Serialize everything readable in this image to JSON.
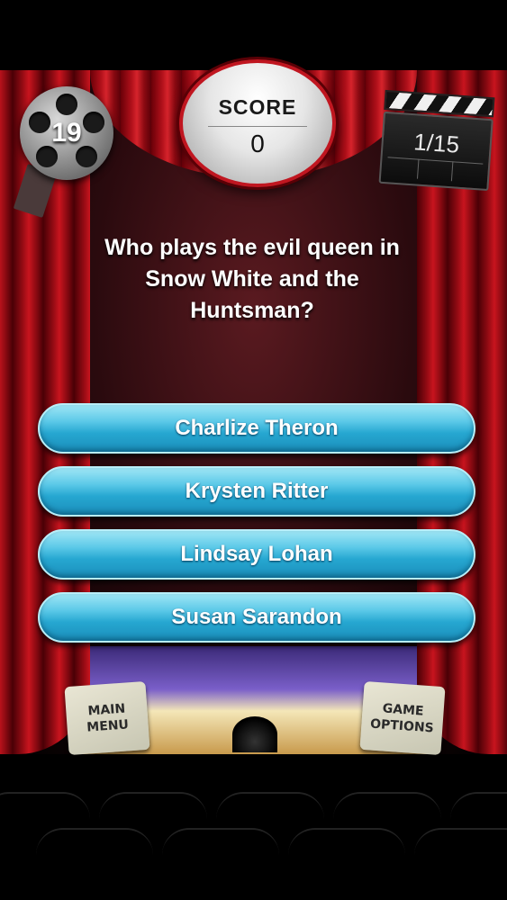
{
  "hud": {
    "timer": "19",
    "score_label": "SCORE",
    "score_value": "0",
    "question_progress": "1/15"
  },
  "question": {
    "line1": "Who plays the evil queen in",
    "line2": "Snow White and the",
    "line3": "Huntsman?"
  },
  "answers": [
    {
      "label": "Charlize Theron"
    },
    {
      "label": "Krysten Ritter"
    },
    {
      "label": "Lindsay Lohan"
    },
    {
      "label": "Susan Sarandon"
    }
  ],
  "buttons": {
    "main_menu_line1": "MAIN",
    "main_menu_line2": "MENU",
    "game_options_line1": "GAME",
    "game_options_line2": "OPTIONS"
  },
  "colors": {
    "answer_button": "#26a7d1",
    "curtain": "#c8141e",
    "score_border": "#c01620"
  },
  "icons": [
    "film-reel-icon",
    "clapperboard-icon"
  ]
}
